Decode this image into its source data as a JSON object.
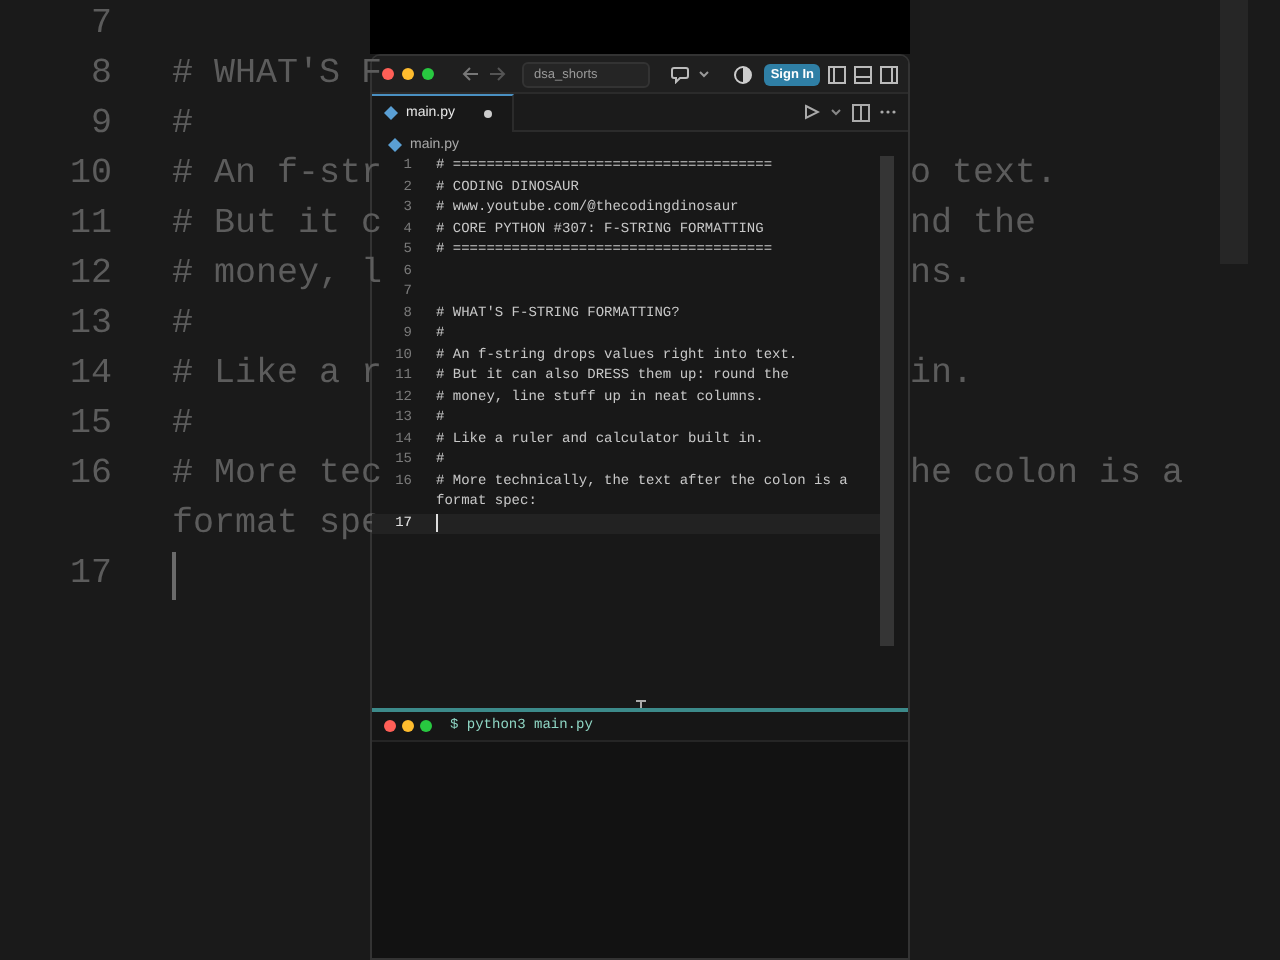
{
  "background": {
    "lines": [
      {
        "number": "7"
      },
      {
        "number": "8",
        "left": "# WHAT'S F"
      },
      {
        "number": "9",
        "left": "#"
      },
      {
        "number": "10",
        "left": "# An f-str",
        "right": "o text."
      },
      {
        "number": "11",
        "left": "# But it c",
        "right": "nd the"
      },
      {
        "number": "12",
        "left": "# money, l",
        "right": "ns."
      },
      {
        "number": "13",
        "left": "#"
      },
      {
        "number": "14",
        "left": "# Like a r",
        "right": "in."
      },
      {
        "number": "15",
        "left": "#"
      },
      {
        "number": "16",
        "left": "# More tec",
        "right": "he colon is a"
      },
      {
        "left": "format spe"
      },
      {
        "number": "17",
        "current": true
      }
    ]
  },
  "window": {
    "search": "dsa_shorts",
    "sign_in": "Sign In",
    "tabs": [
      {
        "label": "main.py",
        "selected": true,
        "modified": true
      }
    ],
    "breadcrumb": "main.py",
    "lines": [
      {
        "number": "1",
        "text": "# ======================================",
        "current": false
      },
      {
        "number": "2",
        "text": "# CODING DINOSAUR",
        "current": false
      },
      {
        "number": "3",
        "text": "# www.youtube.com/@thecodingdinosaur",
        "current": false
      },
      {
        "number": "4",
        "text": "# CORE PYTHON #307: F-STRING FORMATTING",
        "current": false
      },
      {
        "number": "5",
        "text": "# ======================================",
        "current": false
      },
      {
        "number": "6",
        "current": false
      },
      {
        "number": "7",
        "current": false
      },
      {
        "number": "8",
        "text": "# WHAT'S F-STRING FORMATTING?",
        "current": false
      },
      {
        "number": "9",
        "text": "#",
        "current": false
      },
      {
        "number": "10",
        "text": "# An f-string drops values right into text.",
        "current": false
      },
      {
        "number": "11",
        "text": "# But it can also DRESS them up: round the",
        "current": false
      },
      {
        "number": "12",
        "text": "# money, line stuff up in neat columns.",
        "current": false
      },
      {
        "number": "13",
        "text": "#",
        "current": false
      },
      {
        "number": "14",
        "text": "# Like a ruler and calculator built in.",
        "current": false
      },
      {
        "number": "15",
        "text": "#",
        "current": false
      },
      {
        "number": "16",
        "text": "# More technically, the text after the colon is a format spec:",
        "current": false
      },
      {
        "number": "17",
        "current": true
      }
    ],
    "terminal": {
      "command": "$ python3 main.py"
    }
  }
}
